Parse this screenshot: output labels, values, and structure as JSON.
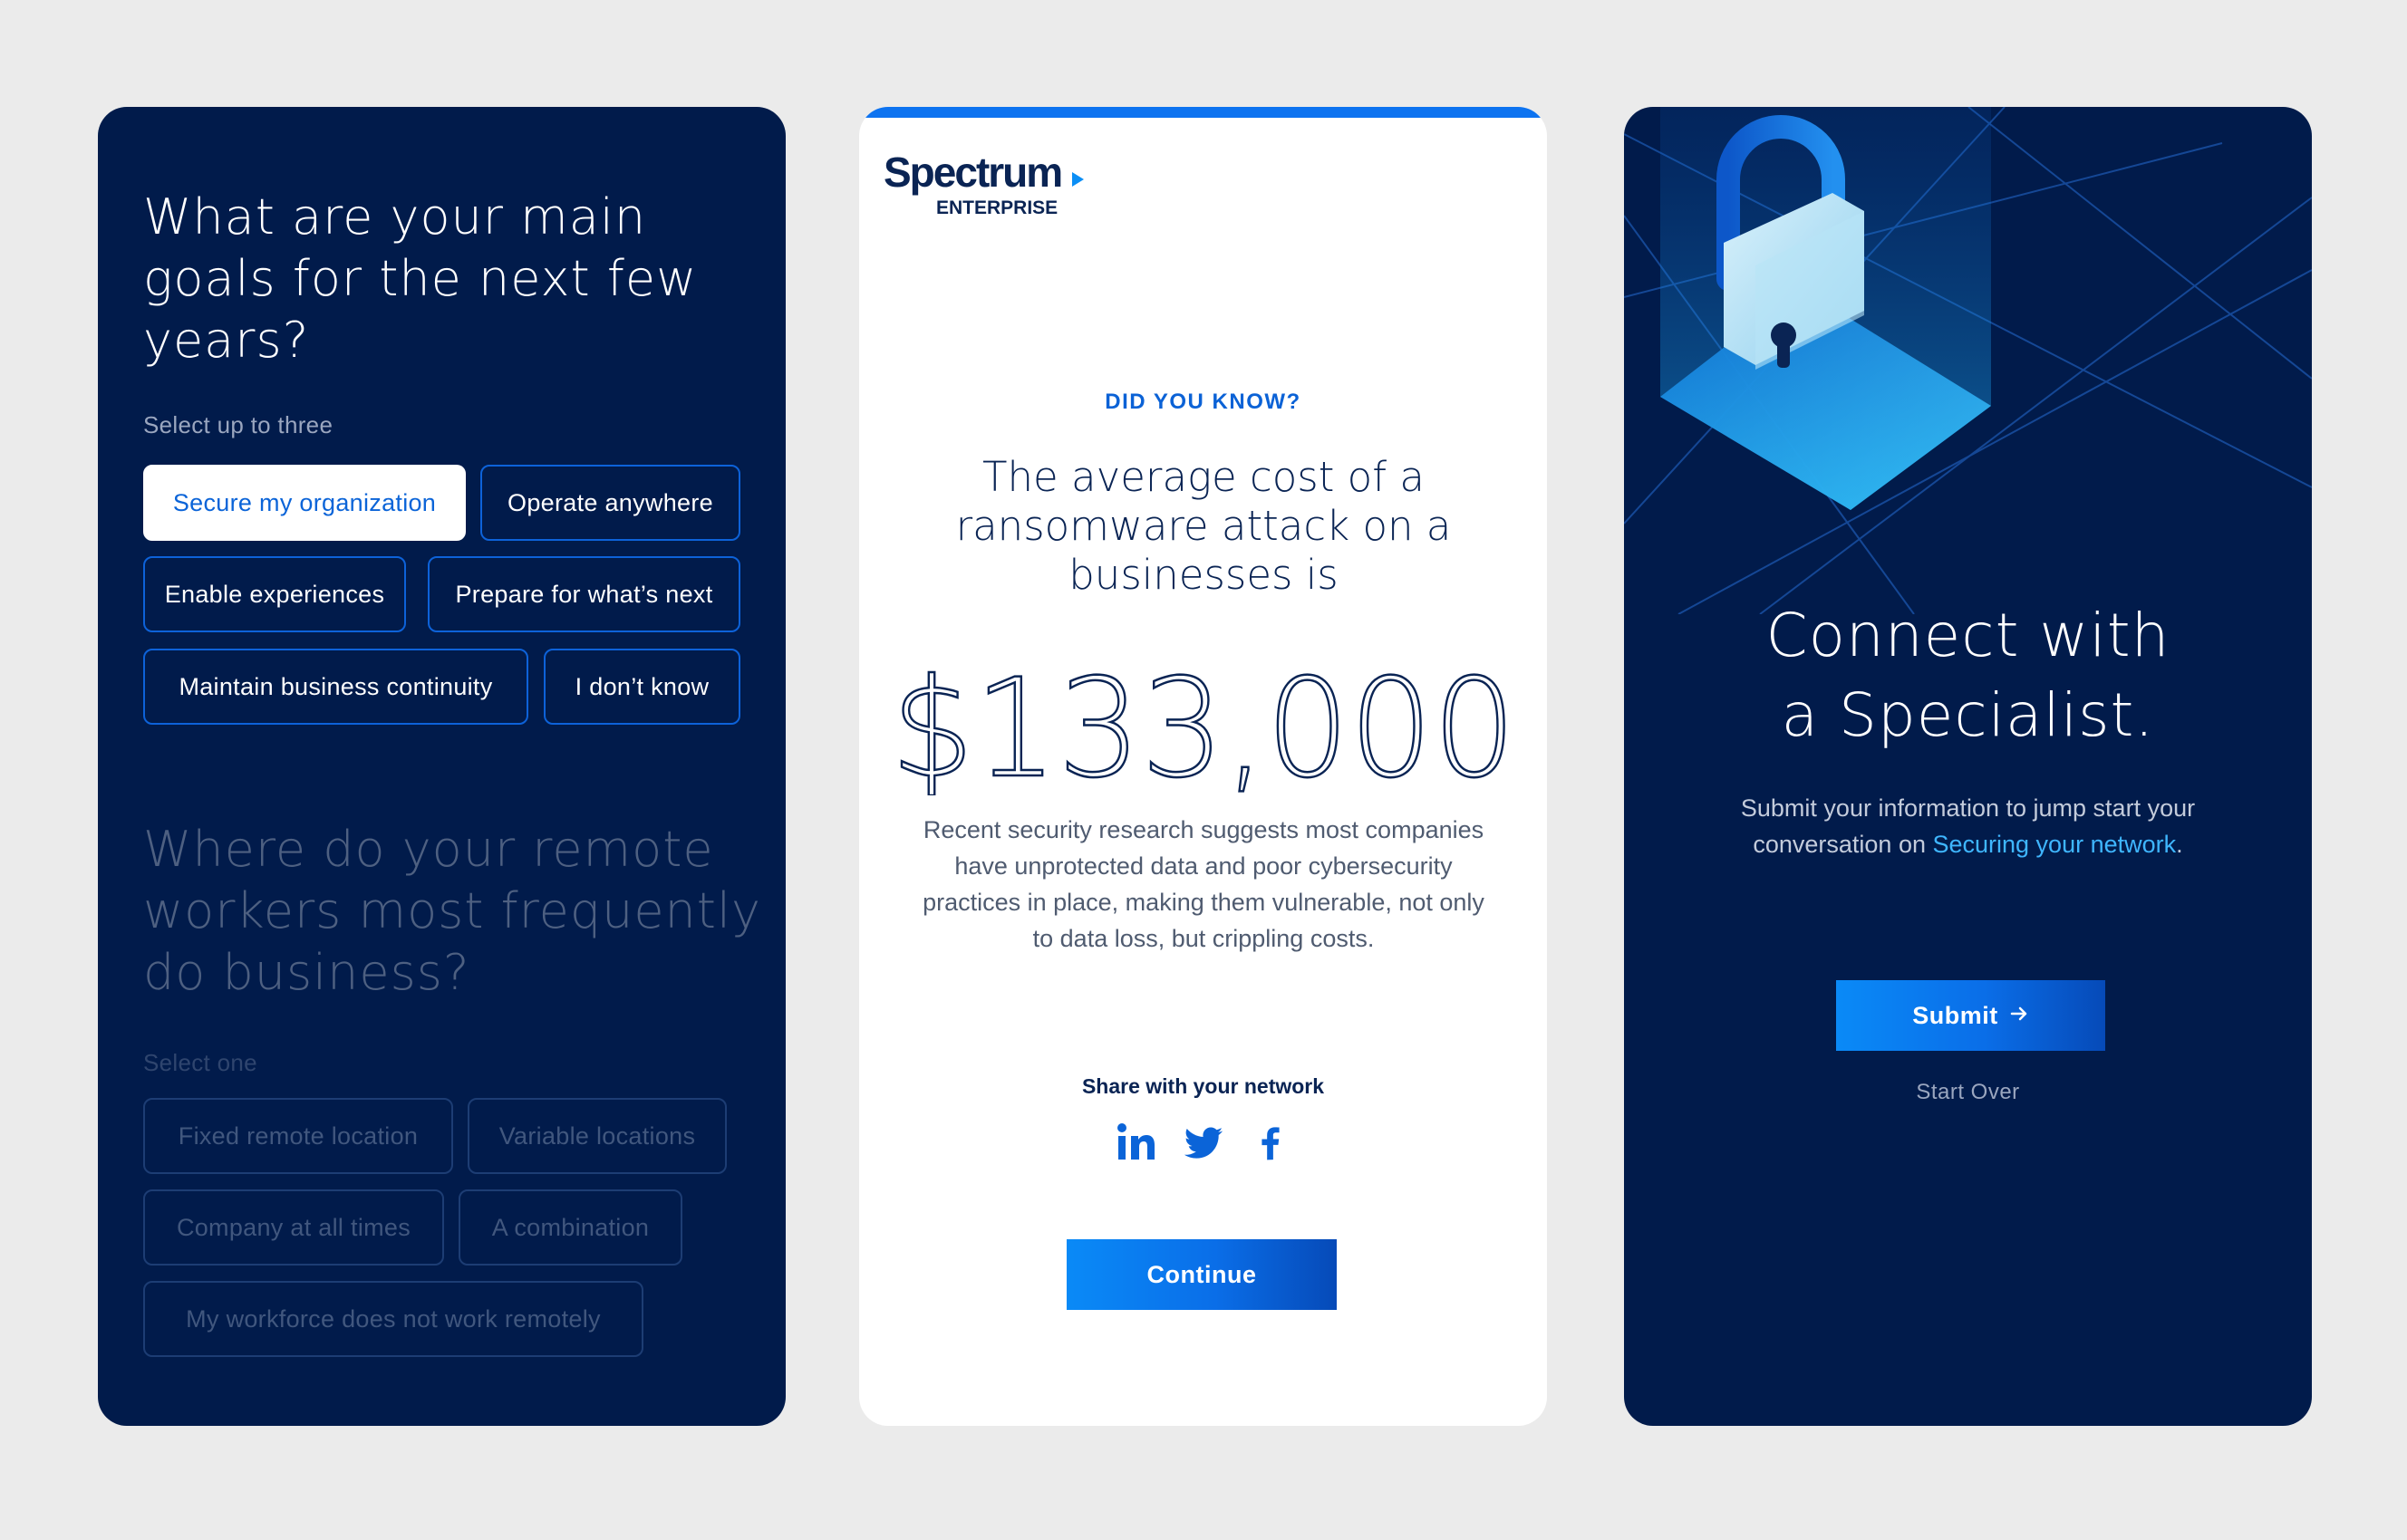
{
  "goals_card": {
    "question": "What are your main goals for the next few years?",
    "hint": "Select up to three",
    "options": [
      {
        "label": "Secure my organization",
        "selected": true
      },
      {
        "label": "Operate anywhere",
        "selected": false
      },
      {
        "label": "Enable experiences",
        "selected": false
      },
      {
        "label": "Prepare for what’s next",
        "selected": false
      },
      {
        "label": "Maintain business continuity",
        "selected": false
      },
      {
        "label": "I don’t know",
        "selected": false
      }
    ],
    "next_question": "Where do your remote workers most frequently do business?",
    "next_hint": "Select one",
    "next_options": [
      {
        "label": "Fixed remote location"
      },
      {
        "label": "Variable locations"
      },
      {
        "label": "Company at all times"
      },
      {
        "label": "A combination"
      },
      {
        "label": "My workforce does not work remotely"
      }
    ]
  },
  "fact_card": {
    "logo": {
      "brand": "Spectrum",
      "sub": "ENTERPRISE"
    },
    "eyebrow": "DID YOU KNOW?",
    "statement": "The average cost of a ransomware attack on a businesses is",
    "amount": "$133,000",
    "body": "Recent security research suggests most companies have unprotected data and poor cybersecurity practices in place, making them vulnerable, not only to data loss, but crippling costs.",
    "share_label": "Share with your network",
    "social_icons": [
      "linkedin-icon",
      "twitter-icon",
      "facebook-icon"
    ],
    "continue_label": "Continue"
  },
  "specialist_card": {
    "title_line1": "Connect with",
    "title_line2": "a Specialist.",
    "copy_before": "Submit your information to jump start your conversation on ",
    "copy_link": "Securing your network",
    "copy_after": ".",
    "submit_label": "Submit",
    "start_over_label": "Start Over"
  },
  "colors": {
    "navy": "#011b4b",
    "accent_blue": "#0b64d8",
    "link_blue": "#3fb6ff",
    "page_bg": "#ebebeb"
  }
}
